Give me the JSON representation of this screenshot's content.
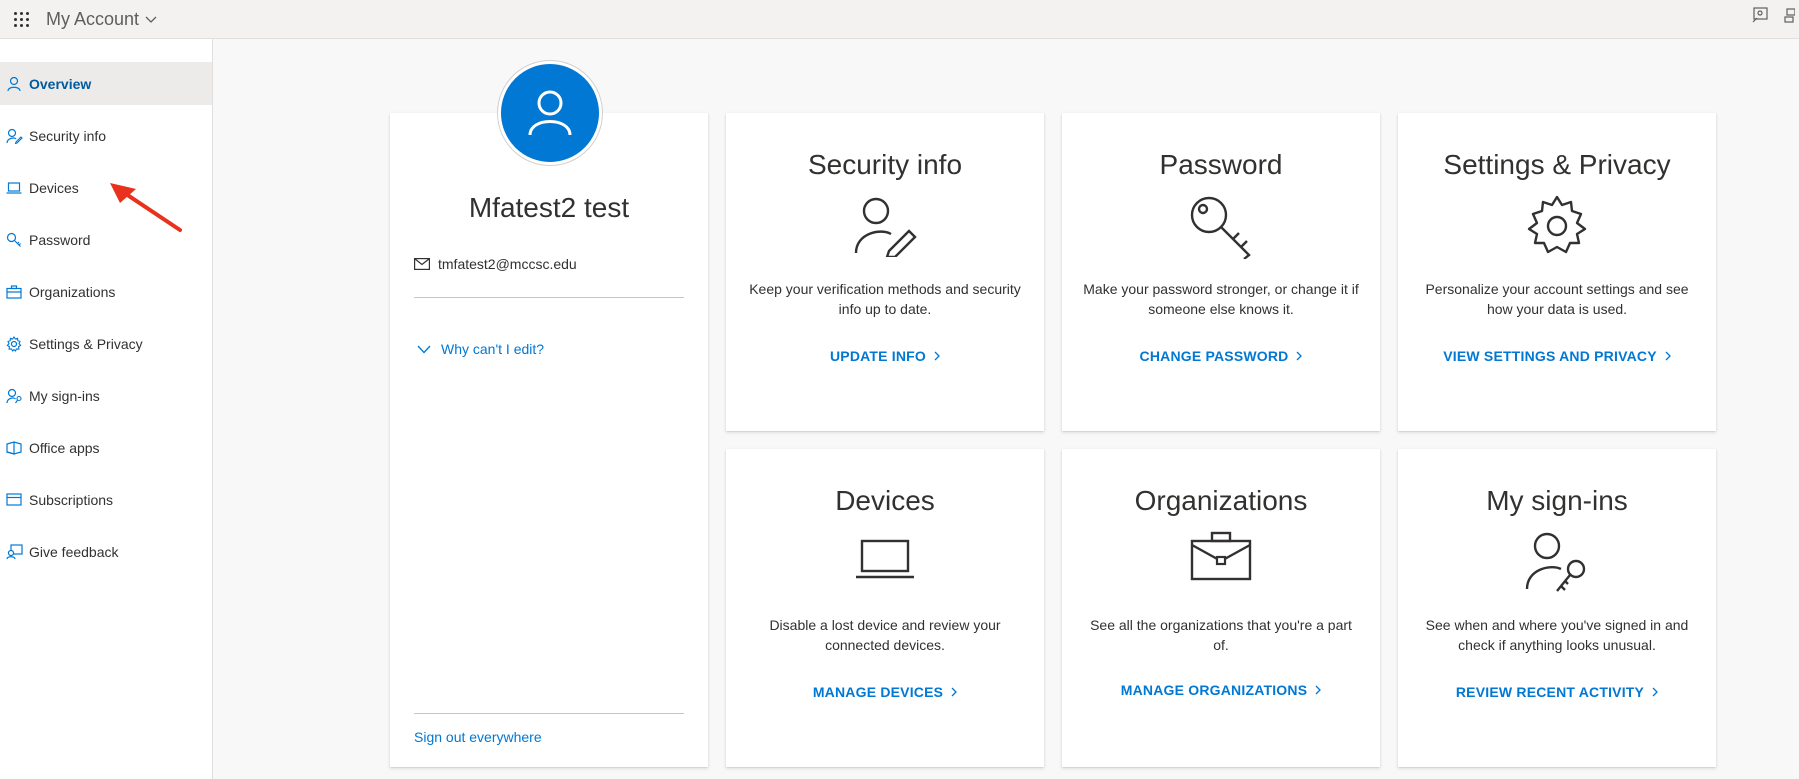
{
  "header": {
    "app_title": "My Account",
    "waffle_icon": "app-launcher-icon",
    "right_icons": [
      "feedback-icon",
      "org-icon"
    ]
  },
  "sidebar": {
    "items": [
      {
        "label": "Overview",
        "icon": "person-icon",
        "active": true
      },
      {
        "label": "Security info",
        "icon": "person-edit-icon"
      },
      {
        "label": "Devices",
        "icon": "laptop-icon"
      },
      {
        "label": "Password",
        "icon": "key-icon"
      },
      {
        "label": "Organizations",
        "icon": "briefcase-icon"
      },
      {
        "label": "Settings & Privacy",
        "icon": "gear-icon"
      },
      {
        "label": "My sign-ins",
        "icon": "person-key-icon"
      },
      {
        "label": "Office apps",
        "icon": "office-icon"
      },
      {
        "label": "Subscriptions",
        "icon": "card-icon"
      },
      {
        "label": "Give feedback",
        "icon": "feedback-icon"
      }
    ]
  },
  "profile": {
    "name": "Mfatest2 test",
    "email": "tmfatest2@mccsc.edu",
    "why_link": "Why can't I edit?",
    "signout_link": "Sign out everywhere"
  },
  "tiles": [
    {
      "title": "Security info",
      "desc": "Keep your verification methods and security info up to date.",
      "link": "UPDATE INFO",
      "icon": "person-edit-icon"
    },
    {
      "title": "Password",
      "desc": "Make your password stronger, or change it if someone else knows it.",
      "link": "CHANGE PASSWORD",
      "icon": "key-icon"
    },
    {
      "title": "Settings & Privacy",
      "desc": "Personalize your account settings and see how your data is used.",
      "link": "VIEW SETTINGS AND PRIVACY",
      "icon": "gear-icon"
    },
    {
      "title": "Devices",
      "desc": "Disable a lost device and review your connected devices.",
      "link": "MANAGE DEVICES",
      "icon": "laptop-icon"
    },
    {
      "title": "Organizations",
      "desc": "See all the organizations that you're a part of.",
      "link": "MANAGE ORGANIZATIONS",
      "icon": "briefcase-icon"
    },
    {
      "title": "My sign-ins",
      "desc": "See when and where you've signed in and check if anything looks unusual.",
      "link": "REVIEW RECENT ACTIVITY",
      "icon": "person-key-icon"
    }
  ],
  "colors": {
    "accent": "#0078d4",
    "annotation_arrow": "#e8321e"
  }
}
